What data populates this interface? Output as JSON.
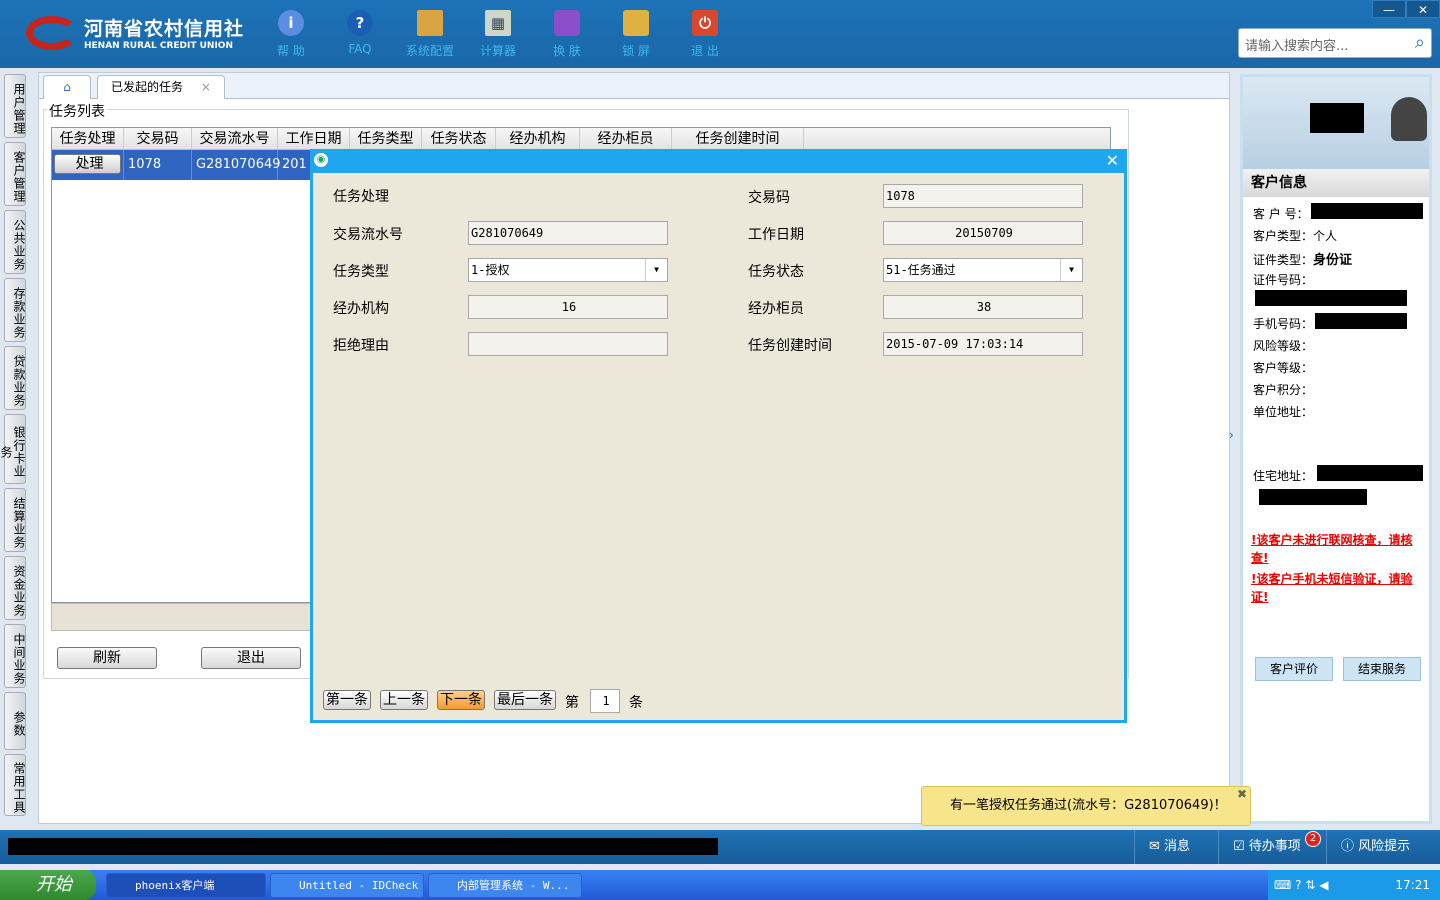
{
  "header": {
    "logo_cn": "河南省农村信用社",
    "logo_en": "HENAN RURAL CREDIT UNION",
    "tools": [
      {
        "label": "帮 助",
        "icon": "info-icon"
      },
      {
        "label": "FAQ",
        "icon": "question-icon"
      },
      {
        "label": "系统配置",
        "icon": "toolbox-icon"
      },
      {
        "label": "计算器",
        "icon": "calculator-icon"
      },
      {
        "label": "换 肤",
        "icon": "shirt-icon"
      },
      {
        "label": "锁 屏",
        "icon": "lock-icon"
      },
      {
        "label": "退 出",
        "icon": "power-icon"
      }
    ],
    "search_placeholder": "请输入搜索内容...",
    "minimize": "—",
    "close": "✕"
  },
  "sidebar": [
    "用户管理",
    "客户管理",
    "公共业务",
    "存款业务",
    "贷款业务",
    "银行卡业务",
    "结算业务",
    "资金业务",
    "中间业务",
    "参数",
    "常用工具"
  ],
  "tabs": {
    "active": "已发起的任务",
    "close": "×"
  },
  "task_list": {
    "legend": "任务列表",
    "columns": [
      "任务处理",
      "交易码",
      "交易流水号",
      "工作日期",
      "任务类型",
      "任务状态",
      "经办机构",
      "经办柜员",
      "任务创建时间"
    ],
    "row": {
      "action": "处理",
      "code": "1078",
      "serial": "G281070649",
      "date": "201"
    },
    "refresh": "刷新",
    "exit": "退出"
  },
  "dialog": {
    "close": "✕",
    "section": "任务处理",
    "fields": {
      "code_label": "交易码",
      "code": "1078",
      "serial_label": "交易流水号",
      "serial": "G281070649",
      "date_label": "工作日期",
      "date": "20150709",
      "type_label": "任务类型",
      "type": "1-授权",
      "status_label": "任务状态",
      "status": "51-任务通过",
      "org_label": "经办机构",
      "org": "16",
      "teller_label": "经办柜员",
      "teller": "38",
      "reason_label": "拒绝理由",
      "reason": "",
      "created_label": "任务创建时间",
      "created": "2015-07-09 17:03:14"
    },
    "nav": {
      "first": "第一条",
      "prev": "上一条",
      "next": "下一条",
      "last": "最后一条",
      "page_prefix": "第",
      "page": "1",
      "page_suffix": "条"
    }
  },
  "customer": {
    "title": "客户信息",
    "items": [
      {
        "label": "客 户 号：",
        "value": ""
      },
      {
        "label": "客户类型：",
        "value": "个人"
      },
      {
        "label": "证件类型：",
        "value": "身份证"
      },
      {
        "label": "证件号码：",
        "value": ""
      },
      {
        "label": "手机号码：",
        "value": ""
      },
      {
        "label": "风险等级：",
        "value": ""
      },
      {
        "label": "客户等级：",
        "value": ""
      },
      {
        "label": "客户积分：",
        "value": ""
      },
      {
        "label": "单位地址：",
        "value": ""
      },
      {
        "label": "住宅地址：",
        "value": ""
      }
    ],
    "warn1": "!该客户未进行联网核查，请核查!",
    "warn2": "!该客户手机未短信验证，请验证!",
    "rate": "客户评价",
    "end": "结束服务"
  },
  "toast": {
    "text": "有一笔授权任务通过(流水号：G281070649)！",
    "close": "✖"
  },
  "status": {
    "messages": "消息",
    "todo": "待办事项",
    "todo_count": "2",
    "risk": "风险提示"
  },
  "taskbar": {
    "start": "开始",
    "tasks": [
      "phoenix客户端",
      "Untitled - IDCheck",
      "内部管理系统 - W..."
    ],
    "time": "17:21"
  }
}
